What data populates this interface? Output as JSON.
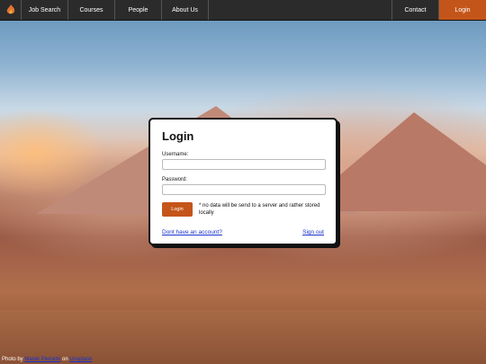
{
  "nav": {
    "logo_icon": "flame-logo-icon",
    "items": [
      "Job Search",
      "Courses",
      "People",
      "About Us"
    ],
    "contact": "Contact",
    "login": "Login",
    "accent_color": "#c4551a"
  },
  "login_form": {
    "title": "Login",
    "username_label": "Username:",
    "username_value": "",
    "password_label": "Password:",
    "password_value": "",
    "submit_label": "Login",
    "note": "* no data will be send to a server and rather stored locally",
    "no_account_link": "Dont have an account?",
    "sign_out_link": "Sign out"
  },
  "credit": {
    "prefix": "Photo by",
    "author": "Marek Piwnicki",
    "middle": "on",
    "source": "Unsplash"
  }
}
